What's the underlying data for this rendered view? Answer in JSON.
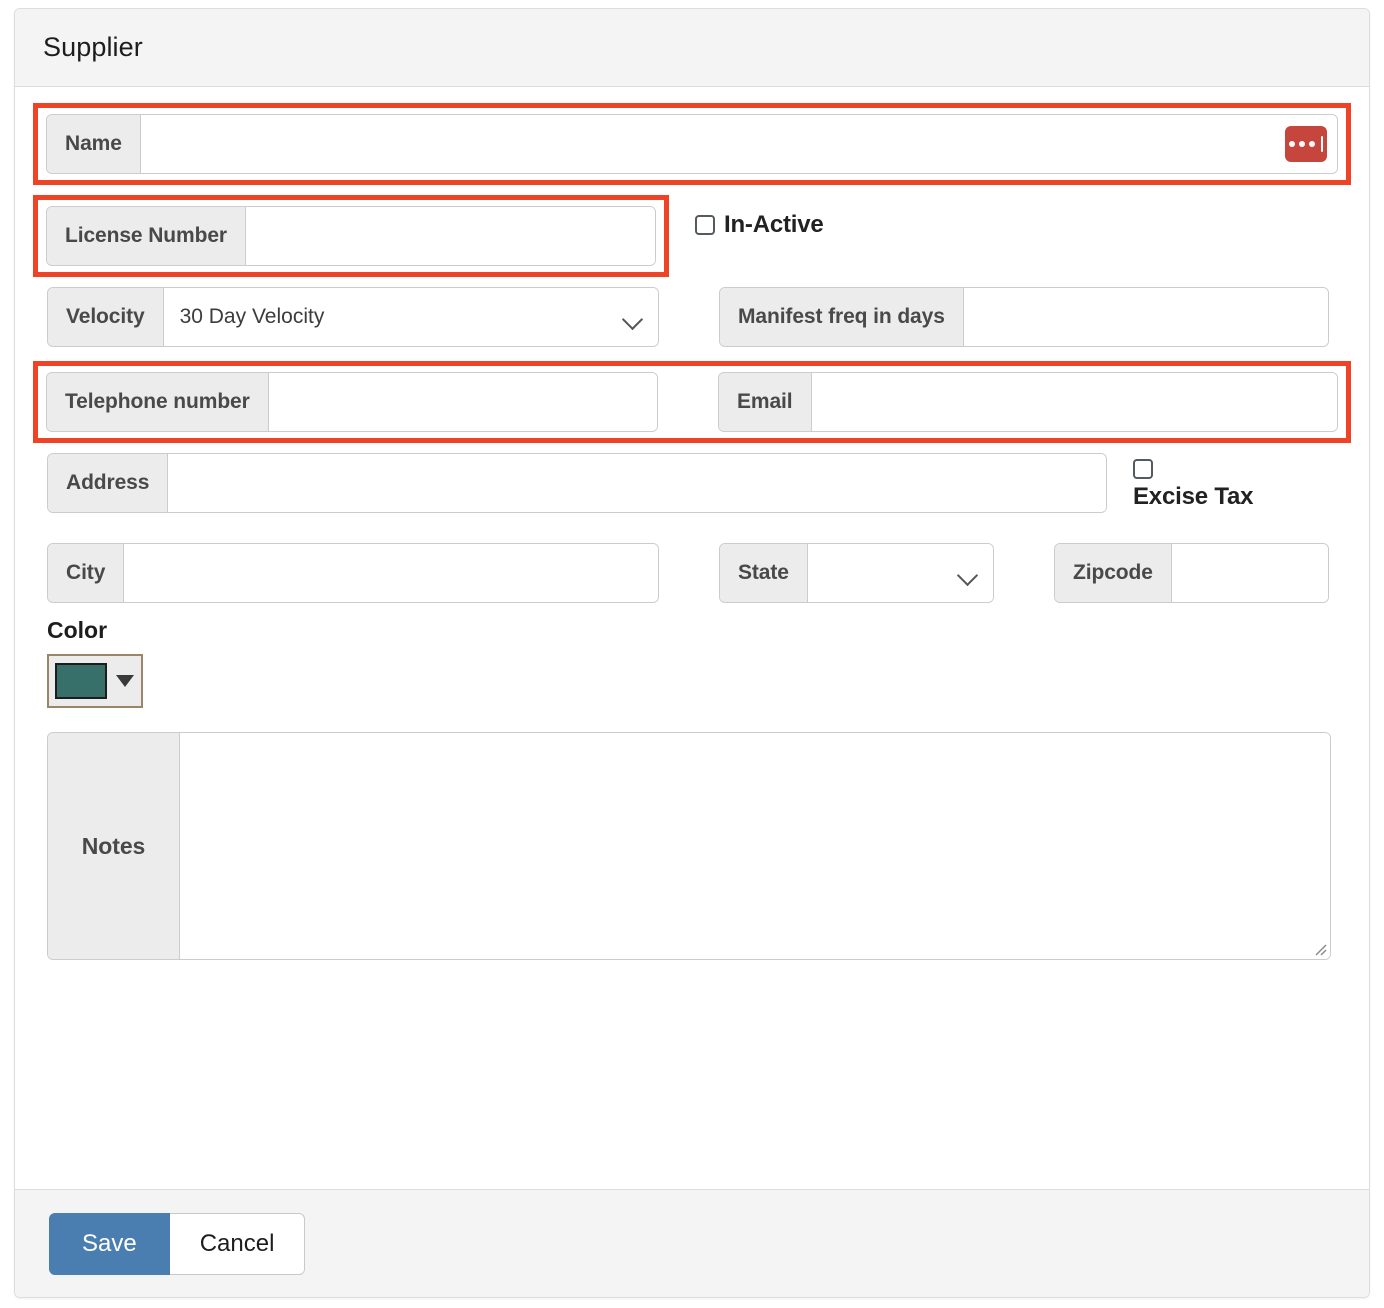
{
  "window": {
    "title": "Supplier"
  },
  "colors": {
    "highlight": "#ee4326",
    "accent_button": "#4a7eb0",
    "ellipsis_button": "#c6453c",
    "swatch": "#37706b",
    "header_bg": "#f4f4f4",
    "addon_bg": "#ececec"
  },
  "form": {
    "name": {
      "label": "Name",
      "value": "",
      "placeholder": "",
      "ellipsis_icon": "ellipsis-icon",
      "highlighted": true
    },
    "license_number": {
      "label": "License Number",
      "value": "",
      "placeholder": "",
      "highlighted": true
    },
    "inactive": {
      "label": "In-Active",
      "checked": false
    },
    "velocity": {
      "label": "Velocity",
      "selected": "30 Day Velocity",
      "options": [
        "30 Day Velocity"
      ],
      "chevron_icon": "chevron-down-icon"
    },
    "manifest_freq": {
      "label": "Manifest freq in days",
      "value": "",
      "placeholder": ""
    },
    "telephone": {
      "label": "Telephone number",
      "value": "",
      "placeholder": "",
      "highlighted": true
    },
    "email": {
      "label": "Email",
      "value": "",
      "placeholder": "",
      "highlighted": true
    },
    "address": {
      "label": "Address",
      "value": "",
      "placeholder": ""
    },
    "excise_tax": {
      "label": "Excise Tax",
      "checked": false
    },
    "city": {
      "label": "City",
      "value": "",
      "placeholder": ""
    },
    "state": {
      "label": "State",
      "selected": "",
      "options": [],
      "chevron_icon": "chevron-down-icon"
    },
    "zipcode": {
      "label": "Zipcode",
      "value": "",
      "placeholder": ""
    },
    "color": {
      "label": "Color",
      "value": "#37706b",
      "caret_icon": "caret-down-icon"
    },
    "notes": {
      "label": "Notes",
      "value": "",
      "placeholder": "",
      "resize_icon": "resize-grip-icon"
    }
  },
  "footer": {
    "save_label": "Save",
    "cancel_label": "Cancel"
  }
}
